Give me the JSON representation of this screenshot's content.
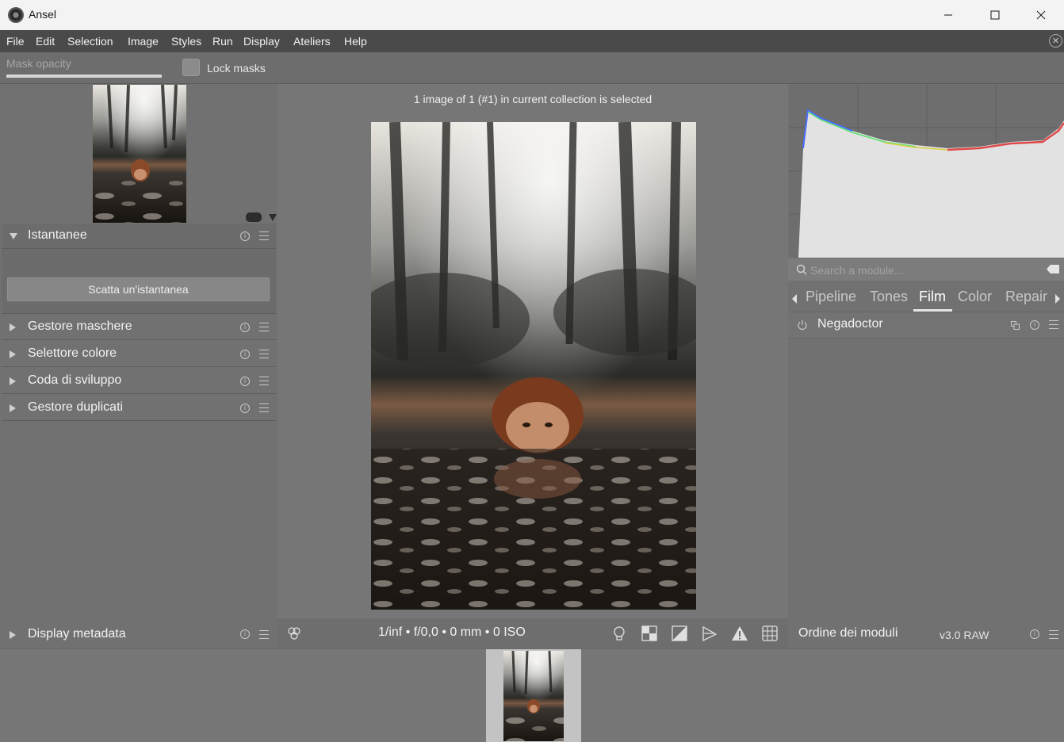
{
  "window": {
    "title": "Ansel"
  },
  "menu": {
    "items": [
      "File",
      "Edit",
      "Selection",
      "Image",
      "Styles",
      "Run",
      "Display",
      "Ateliers",
      "Help"
    ]
  },
  "toolbar": {
    "mask_opacity_label": "Mask opacity",
    "mask_opacity_value": 1.0,
    "lock_masks_label": "Lock masks",
    "lock_masks_checked": false
  },
  "left_panel": {
    "snapshots": {
      "title": "Istantanee",
      "button": "Scatta un'istantanea"
    },
    "modules": [
      "Gestore maschere",
      "Selettore colore",
      "Coda di sviluppo",
      "Gestore duplicati"
    ],
    "bottom_module": "Display metadata"
  },
  "center": {
    "status": "1 image of 1 (#1) in current collection is selected",
    "exif": "1/inf • f/0,0 • 0 mm • 0 ISO"
  },
  "right_panel": {
    "search_placeholder": "Search a module...",
    "tabs": [
      "Pipeline",
      "Tones",
      "Film",
      "Color",
      "Repair"
    ],
    "active_tab": "Film",
    "module": "Negadoctor",
    "order_label": "Ordine dei moduli",
    "order_value": "v3.0 RAW"
  },
  "colors": {
    "menubar": "#4a4a4a",
    "panel": "#717171",
    "center": "#767676",
    "selected_thumb": "#c3c3c3"
  },
  "icons": [
    "app-icon",
    "minimize-icon",
    "maximize-icon",
    "close-icon",
    "info-icon",
    "menu-icon",
    "search-icon",
    "clear-search-icon",
    "power-icon",
    "instance-icon",
    "color-assessment-icon",
    "lightbulb-icon",
    "softproof-icon",
    "gamut-icon",
    "focus-peaking-icon",
    "warning-icon",
    "grid-icon"
  ]
}
